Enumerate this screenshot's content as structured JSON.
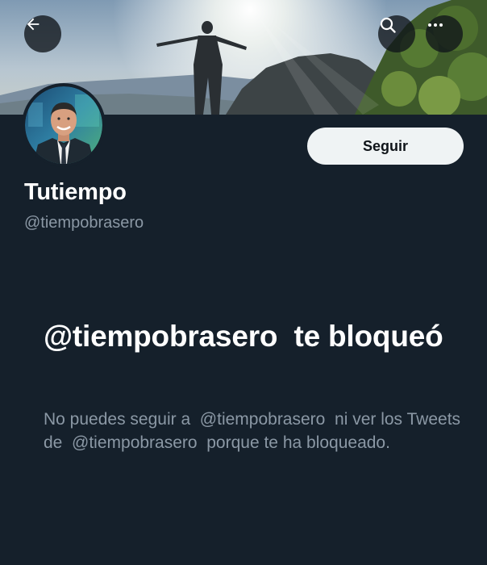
{
  "profile": {
    "display_name": "Tutiempo",
    "handle": "@tiempobrasero"
  },
  "header": {
    "back_icon": "arrow-left-icon",
    "search_icon": "search-icon",
    "more_icon": "more-horizontal-icon"
  },
  "actions": {
    "follow_label": "Seguir"
  },
  "blocked": {
    "title": "@tiempobrasero  te bloqueó",
    "message": "No puedes seguir a  @tiempobrasero  ni ver los Tweets de  @tiempobrasero  porque te ha bloqueado."
  },
  "colors": {
    "background": "#15202b",
    "primary_text": "#ffffff",
    "secondary_text": "#8b98a5",
    "follow_button_bg": "#eff3f4",
    "follow_button_text": "#0f1419"
  }
}
